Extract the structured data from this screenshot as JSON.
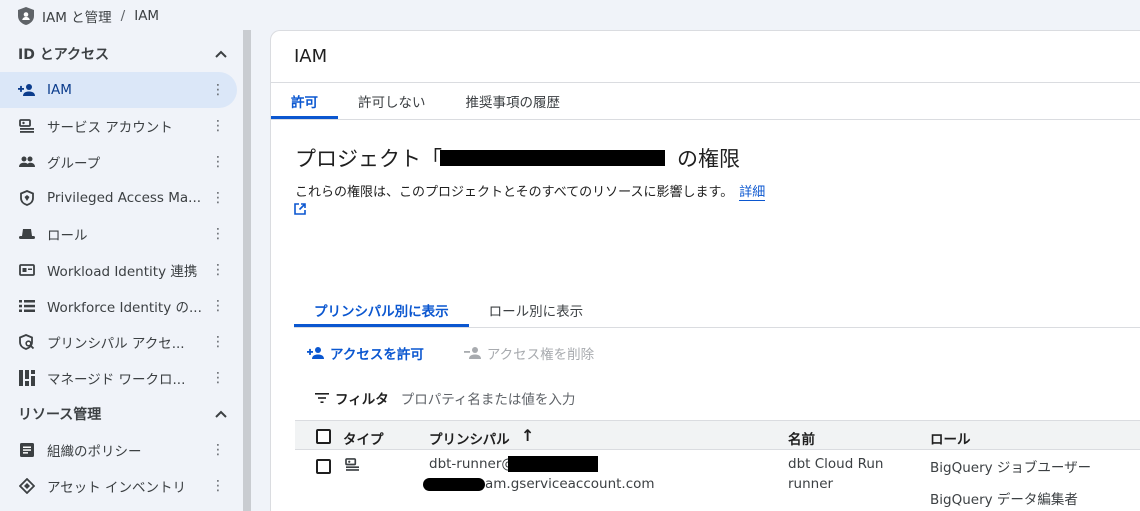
{
  "breadcrumb": {
    "section": "IAM と管理",
    "separator": "/",
    "page": "IAM"
  },
  "sidebar": {
    "sections": [
      {
        "title": "ID とアクセス"
      },
      {
        "title": "リソース管理"
      }
    ],
    "items": [
      {
        "label": "IAM",
        "icon": "person-add-icon",
        "active": true
      },
      {
        "label": "サービス アカウント",
        "icon": "service-account-icon"
      },
      {
        "label": "グループ",
        "icon": "group-icon"
      },
      {
        "label": "Privileged Access Ma...",
        "icon": "shield-icon"
      },
      {
        "label": "ロール",
        "icon": "hat-icon"
      },
      {
        "label": "Workload Identity 連携",
        "icon": "id-card-icon"
      },
      {
        "label": "Workforce Identity の...",
        "icon": "list-icon"
      },
      {
        "label": "プリンシパル アクセ...",
        "icon": "shield-search-icon"
      },
      {
        "label": "マネージド ワークロ...",
        "icon": "dashboard-icon"
      },
      {
        "label": "組織のポリシー",
        "icon": "document-icon"
      },
      {
        "label": "アセット インベントリ",
        "icon": "diamond-icon"
      }
    ]
  },
  "main": {
    "title": "IAM",
    "tabs": [
      "許可",
      "許可しない",
      "推奨事項の履歴"
    ],
    "project_title_prefix": "プロジェクト「",
    "project_title_suffix": "の権限",
    "description": "これらの権限は、このプロジェクトとそのすべてのリソースに影響します。",
    "description_link": "詳細",
    "view_tabs": [
      "プリンシパル別に表示",
      "ロール別に表示"
    ],
    "actions": {
      "grant": "アクセスを許可",
      "remove": "アクセス権を削除"
    },
    "filter": {
      "label": "フィルタ",
      "placeholder": "プロパティ名または値を入力"
    },
    "table": {
      "columns": [
        "タイプ",
        "プリンシパル",
        "名前",
        "ロール"
      ],
      "sort_indicator": "↑",
      "rows": [
        {
          "principal_line1": "dbt-runner@",
          "principal_line2": "am.gserviceaccount.com",
          "name_line1": "dbt Cloud Run",
          "name_line2": "runner",
          "role1": "BigQuery ジョブユーザー",
          "role2": "BigQuery データ編集者"
        }
      ]
    }
  },
  "colors": {
    "accent": "#0b57d0",
    "active_bg": "#dbe7f8",
    "page_bg": "#f0f3f9"
  }
}
